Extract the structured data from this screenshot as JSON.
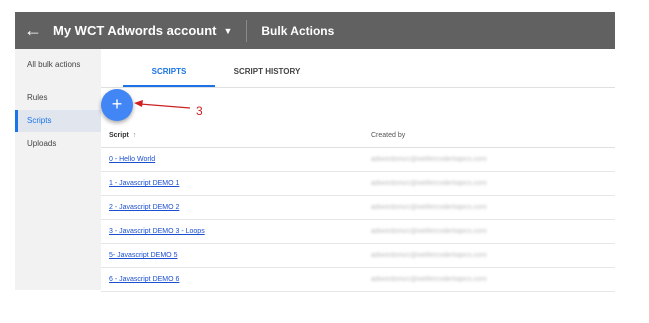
{
  "header": {
    "back_icon": "arrow-back-icon",
    "account_name": "My WCT Adwords account",
    "account_caret": "caret-down-icon",
    "page_title": "Bulk Actions"
  },
  "sidebar": {
    "items": [
      {
        "label": "All bulk actions",
        "active": false
      },
      {
        "label": "Rules",
        "active": false
      },
      {
        "label": "Scripts",
        "active": true
      },
      {
        "label": "Uploads",
        "active": false
      }
    ]
  },
  "tabs": [
    {
      "label": "SCRIPTS",
      "active": true
    },
    {
      "label": "SCRIPT HISTORY",
      "active": false
    }
  ],
  "fab": {
    "label": "+",
    "icon": "add-icon"
  },
  "annotation": {
    "number": "3",
    "color": "#cc2222"
  },
  "table": {
    "columns": [
      "Script",
      "Created by"
    ],
    "sort_icon": "↑",
    "rows": [
      {
        "script": "0 - Hello World",
        "created_by": "adwordsmcc@wellercodertopics.com"
      },
      {
        "script": "1 - Javascript DEMO 1",
        "created_by": "adwordsmcc@wellercodertopics.com"
      },
      {
        "script": "2 - Javascript DEMO 2",
        "created_by": "adwordsmcc@wellercodertopics.com"
      },
      {
        "script": "3 - Javascript DEMO 3 - Loops",
        "created_by": "adwordsmcc@wellercodertopics.com"
      },
      {
        "script": "5- Javascript DEMO 5",
        "created_by": "adwordsmcc@wellercodertopics.com"
      },
      {
        "script": "6 - Javascript DEMO 6",
        "created_by": "adwordsmcc@wellercodertopics.com"
      }
    ]
  },
  "colors": {
    "accent": "#1a73e8",
    "fab": "#4285f4",
    "topbar": "#616161",
    "link": "#1a4fd0"
  }
}
